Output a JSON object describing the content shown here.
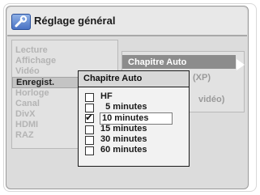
{
  "window": {
    "title": "Réglage général",
    "title_icon": "wrench-icon"
  },
  "menu": {
    "items": [
      {
        "label": "Lecture"
      },
      {
        "label": "Affichage"
      },
      {
        "label": "Vidéo"
      },
      {
        "label": "Enregist.",
        "active": true
      },
      {
        "label": "Horloge"
      },
      {
        "label": "Canal"
      },
      {
        "label": "DivX"
      },
      {
        "label": "HDMI"
      },
      {
        "label": "RAZ"
      }
    ]
  },
  "submenu": {
    "selected_label": "Chapitre Auto",
    "right_arrow_icon": "arrow-right-icon",
    "partial_text_1": "(XP)",
    "partial_text_2": "vidéo)"
  },
  "popup": {
    "title": "Chapitre Auto",
    "options": [
      {
        "label": "HF",
        "checked": false
      },
      {
        "label": "  5 minutes",
        "checked": false
      },
      {
        "label": "10 minutes",
        "checked": true
      },
      {
        "label": "15 minutes",
        "checked": false
      },
      {
        "label": "30 minutes",
        "checked": false
      },
      {
        "label": "60 minutes",
        "checked": false
      }
    ]
  }
}
